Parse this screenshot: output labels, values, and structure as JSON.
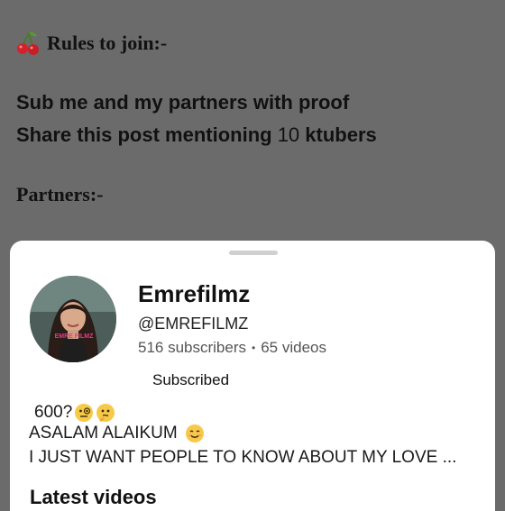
{
  "post": {
    "rules_title": "Rules to join:-",
    "line1": "Sub me and my partners with proof",
    "line2_start": "Share this post mentioning ",
    "line2_number": "10",
    "line2_end": " ktubers",
    "partners_label": "Partners:-",
    "cherry_icon": "cherry-icon"
  },
  "channel": {
    "name": "Emrefilmz",
    "handle": "@EMREFILMZ",
    "subscribers": "516 subscribers",
    "separator": "•",
    "videos": "65 videos",
    "subscribe_button": "Subscribed",
    "avatar_caption": "EMRE FILMZ",
    "description": {
      "line1": "600?",
      "line2": "ASALAM ALAIKUM",
      "line3": "I JUST WANT PEOPLE TO KNOW ABOUT MY LOVE ..."
    },
    "latest_label": "Latest videos"
  }
}
